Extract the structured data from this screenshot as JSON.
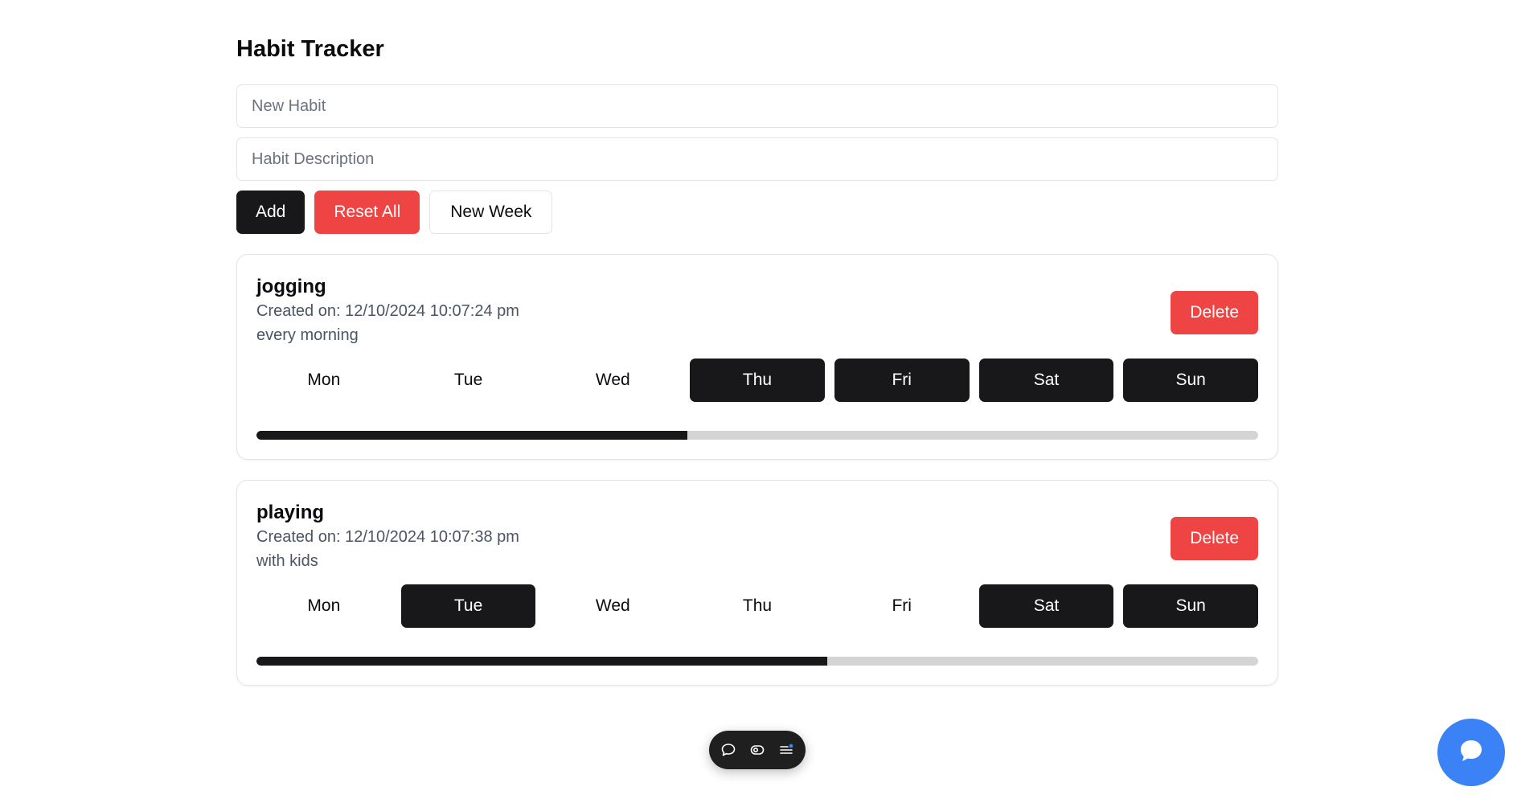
{
  "header": {
    "title": "Habit Tracker"
  },
  "form": {
    "habit_placeholder": "New Habit",
    "description_placeholder": "Habit Description",
    "habit_value": "",
    "description_value": ""
  },
  "actions": {
    "add_label": "Add",
    "reset_label": "Reset All",
    "new_week_label": "New Week"
  },
  "habits": [
    {
      "name": "jogging",
      "created": "Created on: 12/10/2024 10:07:24 pm",
      "description": "every morning",
      "delete_label": "Delete",
      "days": [
        {
          "label": "Mon",
          "done": false
        },
        {
          "label": "Tue",
          "done": false
        },
        {
          "label": "Wed",
          "done": false
        },
        {
          "label": "Thu",
          "done": true
        },
        {
          "label": "Fri",
          "done": true
        },
        {
          "label": "Sat",
          "done": true
        },
        {
          "label": "Sun",
          "done": true
        }
      ],
      "progress": 0.43
    },
    {
      "name": "playing",
      "created": "Created on: 12/10/2024 10:07:38 pm",
      "description": "with kids",
      "delete_label": "Delete",
      "days": [
        {
          "label": "Mon",
          "done": false
        },
        {
          "label": "Tue",
          "done": true
        },
        {
          "label": "Wed",
          "done": false
        },
        {
          "label": "Thu",
          "done": false
        },
        {
          "label": "Fri",
          "done": false
        },
        {
          "label": "Sat",
          "done": true
        },
        {
          "label": "Sun",
          "done": true
        }
      ],
      "progress": 0.57
    }
  ],
  "floating_toolbar": {
    "icons": [
      "comment-icon",
      "eye-toggle-icon",
      "menu-notification-icon"
    ]
  },
  "chat_fab": {
    "icon": "chat-bubble-icon"
  },
  "colors": {
    "dark": "#18181b",
    "danger": "#ef4444",
    "track": "#d4d4d4",
    "fab": "#3b82f6",
    "notify_dot": "#3b82f6"
  }
}
